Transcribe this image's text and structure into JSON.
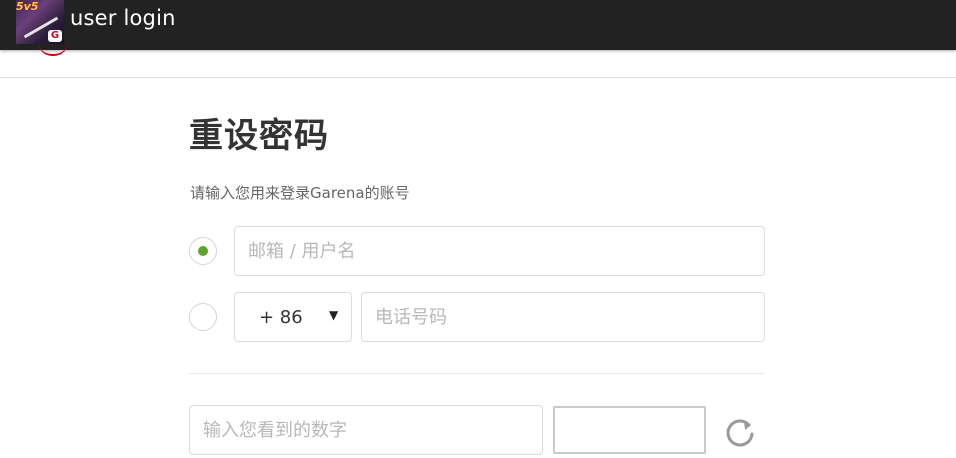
{
  "header": {
    "app_title": "user login",
    "logo_tag": "5v5",
    "logo_mark": "G"
  },
  "form": {
    "title": "重设密码",
    "subtitle": "请输入您用来登录Garena的账号",
    "account_input": {
      "value": "",
      "placeholder": "邮箱 / 用户名",
      "selected": true
    },
    "phone_option": {
      "selected": false,
      "country_code": "+ 86",
      "caret_icon": "dropdown-triangle",
      "phone_input": {
        "value": "",
        "placeholder": "电话号码"
      }
    },
    "captcha": {
      "input": {
        "value": "",
        "placeholder": "输入您看到的数字"
      },
      "refresh_icon": "refresh-icon"
    }
  },
  "colors": {
    "header_bg": "#222222",
    "radio_selected": "#5fa32e",
    "border": "#dcdcdc",
    "placeholder": "#b8b8b8"
  }
}
